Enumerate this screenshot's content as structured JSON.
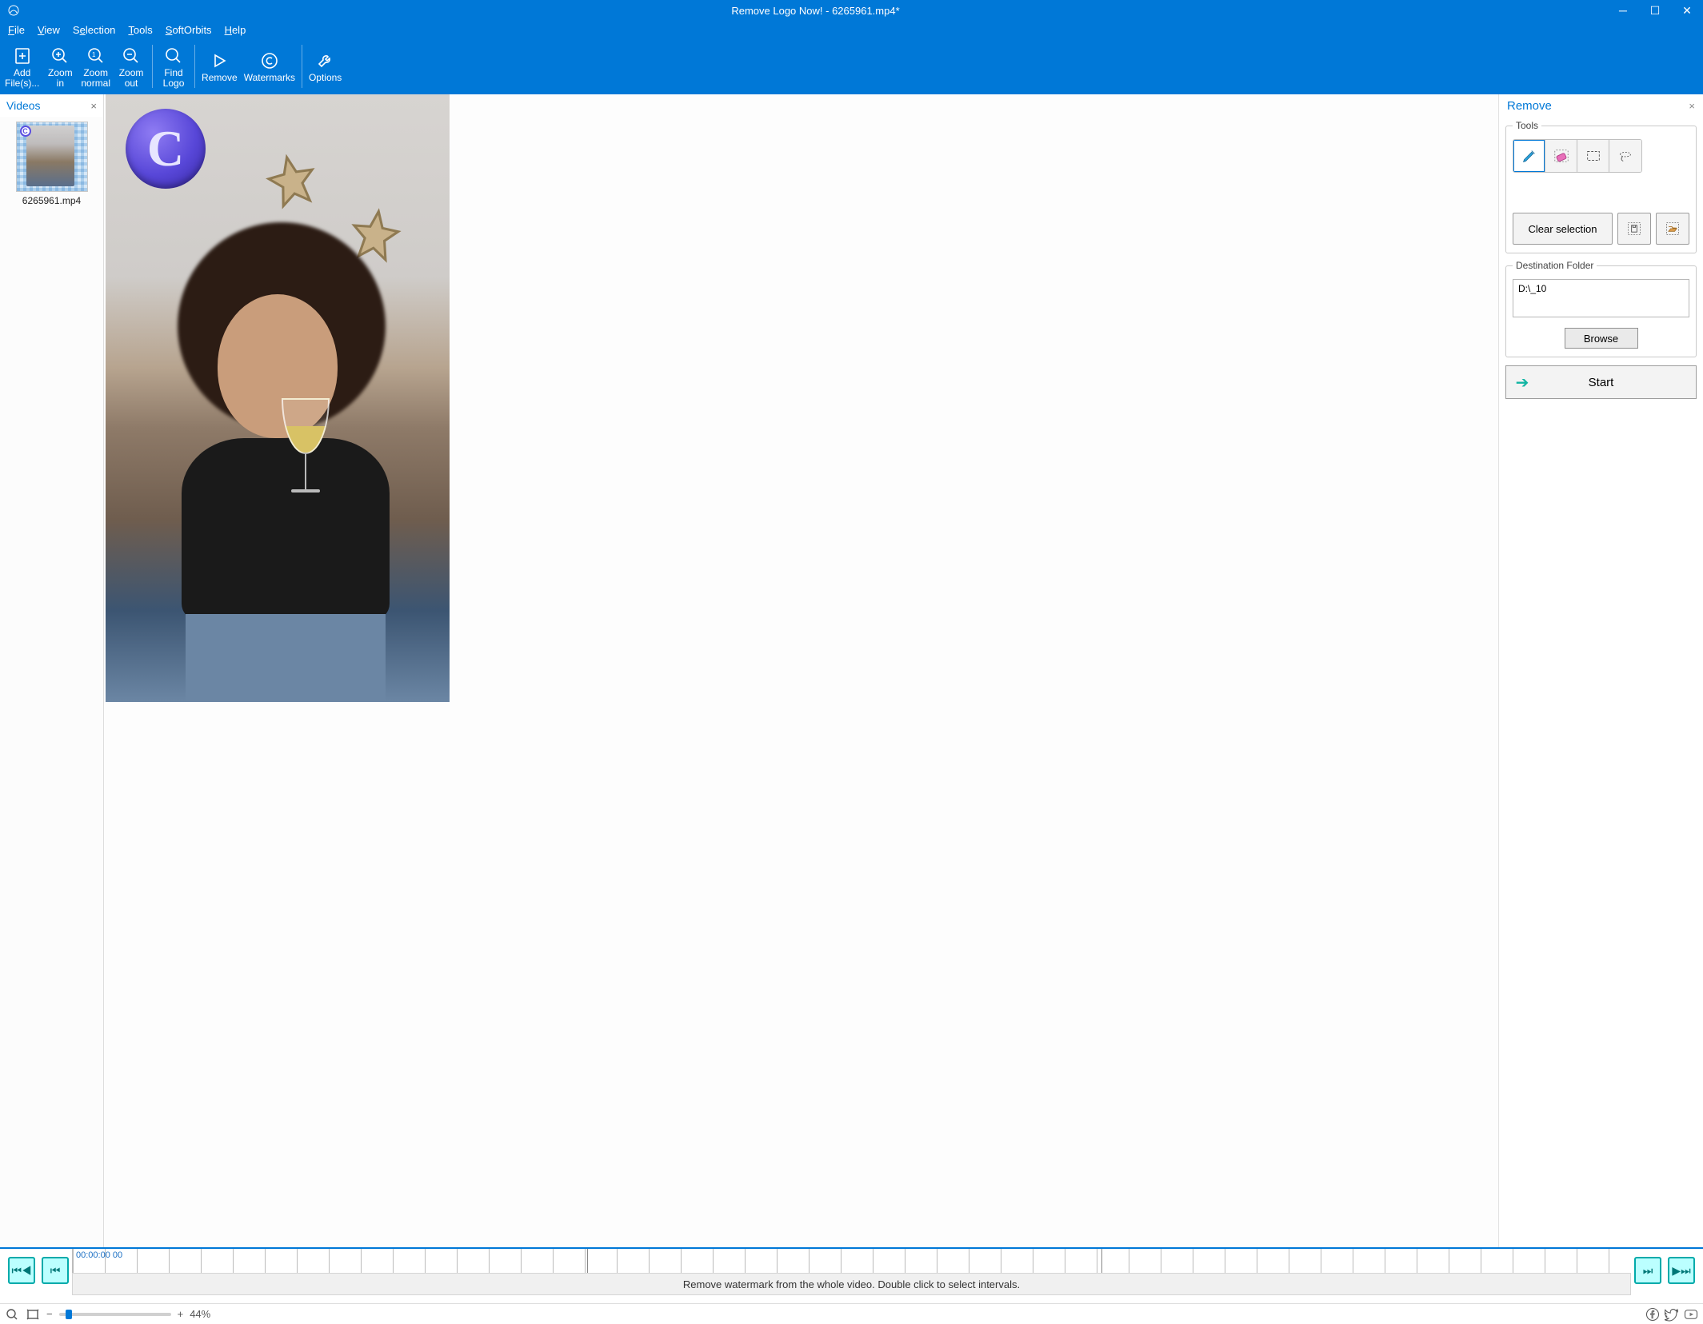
{
  "titlebar": {
    "title": "Remove Logo Now! - 6265961.mp4*"
  },
  "menubar": {
    "file": "File",
    "view": "View",
    "selection": "Selection",
    "tools": "Tools",
    "softorbits": "SoftOrbits",
    "help": "Help"
  },
  "toolbar": {
    "add_files": "Add\nFile(s)...",
    "zoom_in": "Zoom\nin",
    "zoom_normal": "Zoom\nnormal",
    "zoom_out": "Zoom\nout",
    "find_logo": "Find\nLogo",
    "remove": "Remove",
    "watermarks": "Watermarks",
    "options": "Options"
  },
  "left_panel": {
    "title": "Videos",
    "close": "×",
    "thumb_name": "6265961.mp4"
  },
  "right_panel": {
    "title": "Remove",
    "close": "×",
    "tools_legend": "Tools",
    "clear_selection": "Clear selection",
    "destination_legend": "Destination Folder",
    "destination_path": "D:\\_10",
    "browse": "Browse",
    "start": "Start"
  },
  "timeline": {
    "timestamp": "00:00:00 00",
    "hint": "Remove watermark from the whole video. Double click to select intervals."
  },
  "status": {
    "zoom_pct": "44%",
    "minus": "−",
    "plus": "+"
  }
}
